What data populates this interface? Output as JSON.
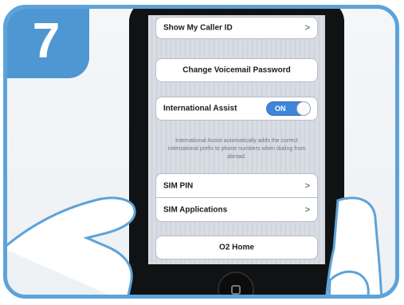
{
  "step": {
    "number": "7"
  },
  "settings": {
    "caller_id_label": "Show My Caller ID",
    "chevron": ">",
    "voicemail_label": "Change Voicemail Password",
    "intl_assist_label": "International Assist",
    "toggle_state": "ON",
    "intl_note": "International Assist automatically adds the correct international prefix to phone numbers when dialing from abroad.",
    "sim_pin_label": "SIM PIN",
    "sim_apps_label": "SIM Applications",
    "o2_home_label": "O2 Home"
  },
  "colors": {
    "frame_blue": "#5da3d9",
    "badge_blue": "#4f97d2",
    "toggle_blue": "#3f86db"
  }
}
